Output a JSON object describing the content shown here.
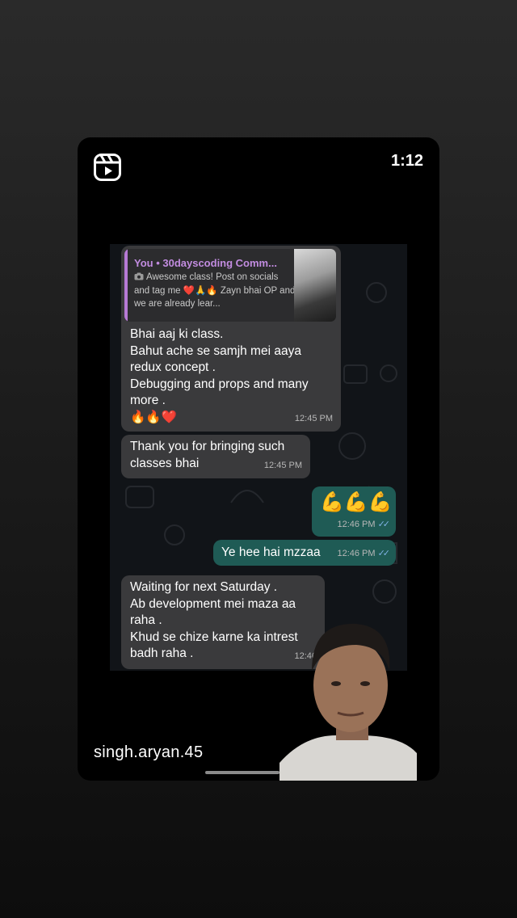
{
  "reel": {
    "timer": "1:12",
    "username": "singh.aryan.45"
  },
  "chat": {
    "reply": {
      "title": "You • 30dayscoding Comm...",
      "text": "Awesome class! Post on socials and tag me ❤️🙏🔥 Zayn bhai OP and we are already lear..."
    },
    "messages": [
      {
        "text": "Bhai aaj ki class.\nBahut ache se samjh mei aaya redux concept .\nDebugging and props and many more .\n🔥🔥❤️",
        "time": "12:45 PM"
      },
      {
        "text": "Thank you for bringing such classes bhai",
        "time": "12:45 PM"
      },
      {
        "text": "💪💪💪",
        "time": "12:46 PM"
      },
      {
        "text": "Ye hee hai mzzaa",
        "time": "12:46 PM"
      },
      {
        "text": "Waiting for next Saturday .\nAb development mei maza aa raha .\nKhud se chize karne ka intrest badh raha .",
        "time": "12:46"
      }
    ]
  },
  "icons": {
    "reels": "reels-icon",
    "camera": "camera-icon",
    "read_ticks": "double-check-icon"
  },
  "colors": {
    "incoming_bubble": "#3a3a3c",
    "outgoing_bubble": "#1f5b55",
    "reply_accent": "#b77ad5",
    "tick_blue": "#7fb2e5"
  }
}
